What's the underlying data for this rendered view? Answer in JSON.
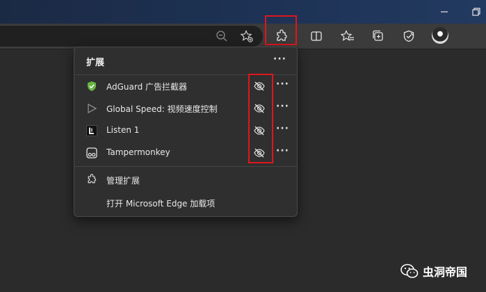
{
  "toolbar": {
    "icons": [
      "zoom-out-icon",
      "favorite-add-icon",
      "extensions-icon",
      "split-screen-icon",
      "favorites-icon",
      "collections-icon",
      "browser-essentials-icon",
      "profile-avatar"
    ]
  },
  "popup": {
    "title": "扩展",
    "header_more": "···",
    "extensions": [
      {
        "name": "AdGuard 广告拦截器",
        "icon": "adguard-shield-icon",
        "more": "···"
      },
      {
        "name": "Global Speed: 视频速度控制",
        "icon": "play-triangle-icon",
        "more": "···"
      },
      {
        "name": "Listen 1",
        "icon": "listen1-logo-icon",
        "more": "···"
      },
      {
        "name": "Tampermonkey",
        "icon": "tampermonkey-icon",
        "more": "···"
      }
    ],
    "footer": {
      "manage": "管理扩展",
      "open_addons": "打开 Microsoft Edge 加载项"
    }
  },
  "watermark": {
    "text": "虫洞帝国"
  },
  "colors": {
    "highlight": "#e0161d",
    "adguard_green": "#67b443"
  }
}
